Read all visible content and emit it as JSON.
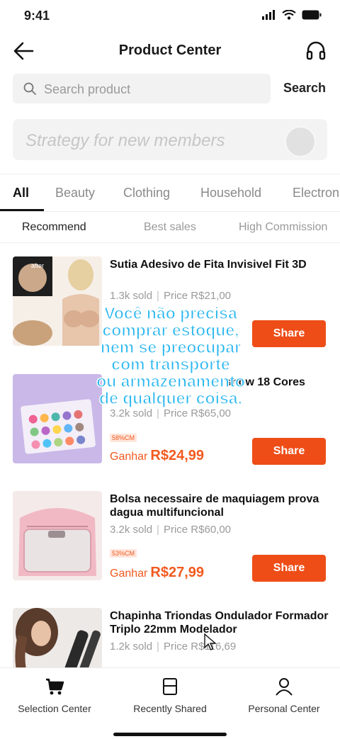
{
  "status": {
    "time": "9:41"
  },
  "header": {
    "title": "Product Center"
  },
  "search": {
    "placeholder": "Search product",
    "button_label": "Search"
  },
  "banner": {
    "text": "Strategy for new members"
  },
  "category_tabs": [
    "All",
    "Beauty",
    "Clothing",
    "Household",
    "Electron"
  ],
  "sort_tabs": [
    "Recommend",
    "Best sales",
    "High Commission"
  ],
  "products": [
    {
      "title": "Sutia Adesivo de Fita Invisivel Fit 3D",
      "sold": "1.3k sold",
      "price": "Price R$21,00",
      "thumb_tag": "after",
      "share_label": "Share"
    },
    {
      "title": "show 18 Cores",
      "sold": "3.2k sold",
      "price": "Price R$65,00",
      "badge": "58%CM",
      "earn_label": "Ganhar",
      "earn_value": "R$24,99",
      "share_label": "Share"
    },
    {
      "title": "Bolsa necessaire de maquiagem prova dagua multifuncional",
      "sold": "3.2k sold",
      "price": "Price R$60,00",
      "badge": "53%CM",
      "earn_label": "Ganhar",
      "earn_value": "R$27,99",
      "share_label": "Share"
    },
    {
      "title": "Chapinha Triondas Ondulador Formador Triplo 22mm Modelador",
      "sold": "1.2k sold",
      "price": "Price R$116,69"
    }
  ],
  "overlay_caption": [
    "Você não precisa",
    "comprar estoque,",
    "nem se preocupar",
    "com transporte",
    "ou armazenamento",
    "de qualquer coisa."
  ],
  "bottom_nav": [
    "Selection Center",
    "Recently Shared",
    "Personal Center"
  ],
  "colors": {
    "accent": "#ee4d17",
    "earn": "#f25a1f",
    "caption": "#2ab7f0"
  }
}
